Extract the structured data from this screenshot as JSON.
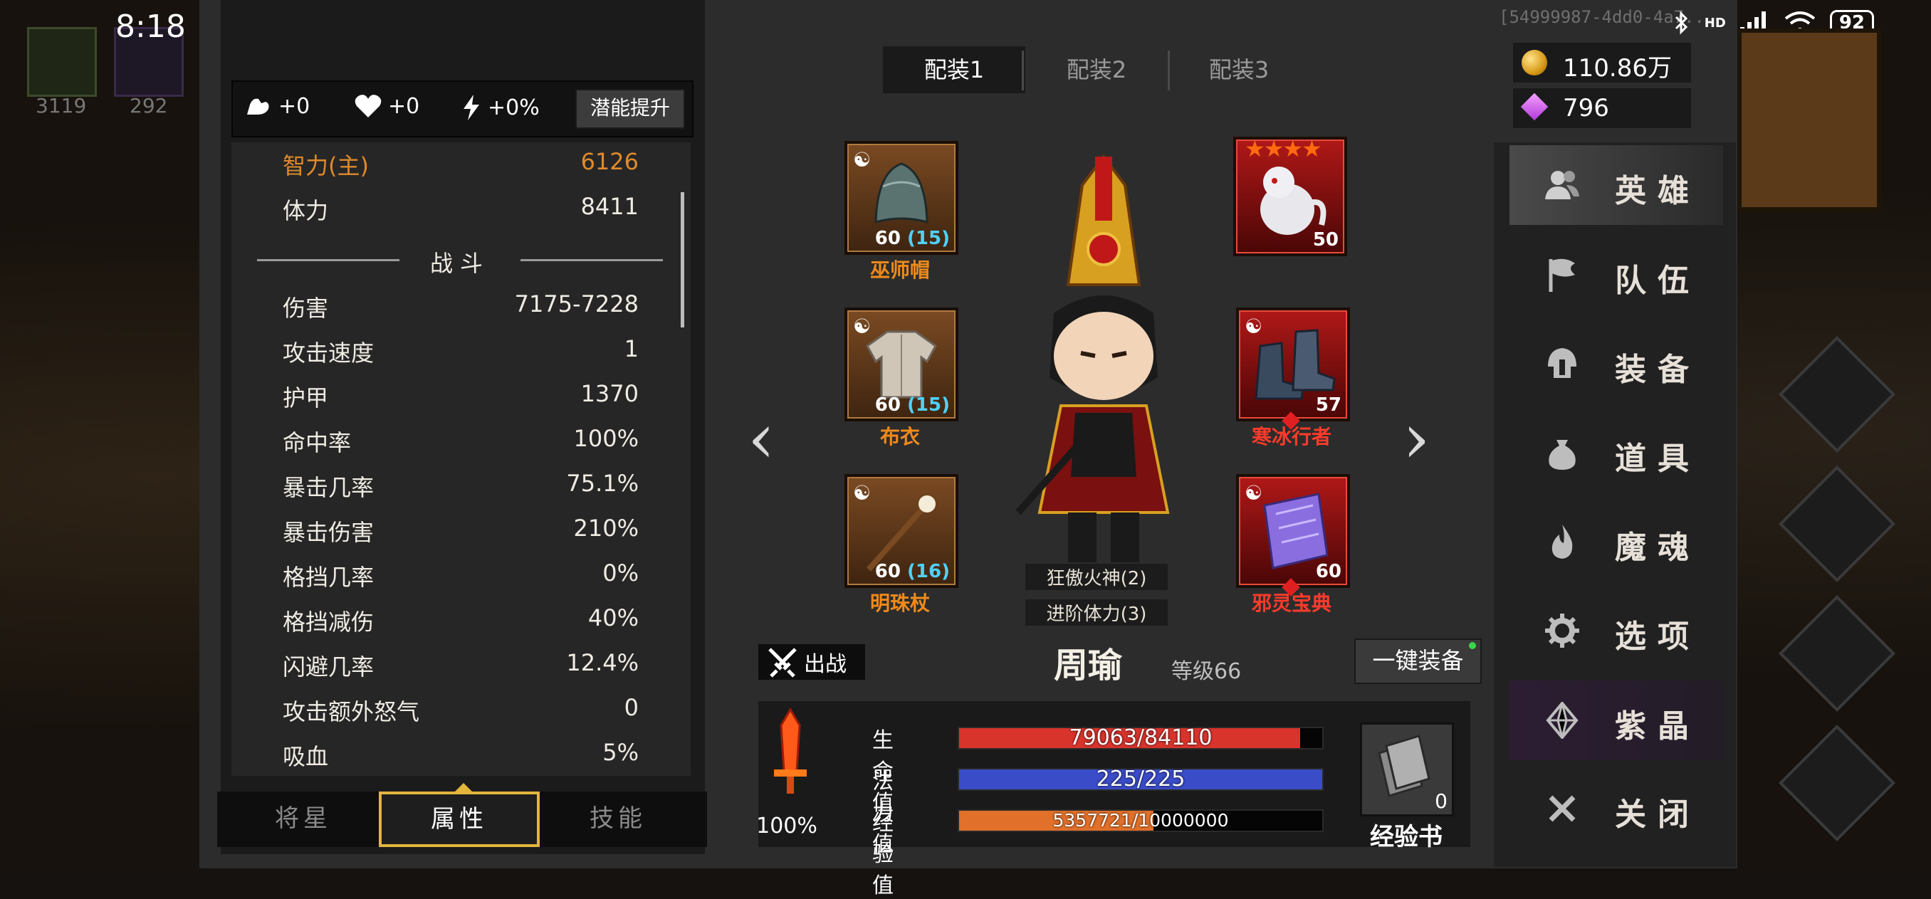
{
  "status_bar": {
    "time": "8:18",
    "debug_id": "[54999987-4dd0-4a7...",
    "network": "HD",
    "battery": "92"
  },
  "left_game": {
    "slot_counts": [
      "3119",
      "292"
    ]
  },
  "potential": {
    "items": [
      {
        "icon": "strength-arm-icon",
        "value": "+0"
      },
      {
        "icon": "heart-icon",
        "value": "+0"
      },
      {
        "icon": "lightning-icon",
        "value": "+0%"
      }
    ],
    "button": "潜能提升"
  },
  "stats": {
    "primary": [
      {
        "label": "智力(主)",
        "value": "6126"
      },
      {
        "label": "体力",
        "value": "8411"
      }
    ],
    "section": "战斗",
    "combat": [
      {
        "label": "伤害",
        "value": "7175-7228"
      },
      {
        "label": "攻击速度",
        "value": "1"
      },
      {
        "label": "护甲",
        "value": "1370"
      },
      {
        "label": "命中率",
        "value": "100%"
      },
      {
        "label": "暴击几率",
        "value": "75.1%"
      },
      {
        "label": "暴击伤害",
        "value": "210%"
      },
      {
        "label": "格挡几率",
        "value": "0%"
      },
      {
        "label": "格挡减伤",
        "value": "40%"
      },
      {
        "label": "闪避几率",
        "value": "12.4%"
      },
      {
        "label": "攻击额外怒气",
        "value": "0"
      },
      {
        "label": "吸血",
        "value": "5%"
      }
    ]
  },
  "bottom_tabs": [
    "将星",
    "属性",
    "技能"
  ],
  "loadout_tabs": [
    "配装1",
    "配装2",
    "配装3"
  ],
  "equipment": {
    "slot1": {
      "name": "巫师帽",
      "level": "60",
      "bonus": "(15)"
    },
    "slot2": {
      "name": "布衣",
      "level": "60",
      "bonus": "(15)"
    },
    "slot3": {
      "name": "明珠杖",
      "level": "60",
      "bonus": "(16)"
    },
    "slot4": {
      "level": "50",
      "stars": "★★★★"
    },
    "slot5": {
      "name": "寒冰行者",
      "level": "57"
    },
    "slot6": {
      "name": "邪灵宝典",
      "level": "60"
    }
  },
  "effects": [
    "狂傲火神(2)",
    "进阶体力(3)"
  ],
  "hero": {
    "sortie": "出战",
    "name": "周瑜",
    "level": "等级66",
    "equip_all": "一键装备"
  },
  "bars": {
    "hp": {
      "label": "生命值",
      "text": "79063/84110",
      "fraction": 0.94
    },
    "mp": {
      "label": "法力值",
      "text": "225/225",
      "fraction": 1.0
    },
    "exp": {
      "label": "经验值",
      "text": "5357721/10000000",
      "fraction": 0.5358
    }
  },
  "rage": "100%",
  "exp_book": {
    "label": "经验书",
    "count": "0"
  },
  "currency": {
    "gold": "110.86万",
    "gems": "796"
  },
  "nav": [
    "英雄",
    "队伍",
    "装备",
    "道具",
    "魔魂",
    "选项",
    "紫晶",
    "关闭"
  ],
  "colors": {
    "accent_gold": "#e3b53c",
    "primary_stat": "#e08a2a",
    "hp": "#d8342c",
    "mp": "#3a4cc8",
    "exp": "#e0702a",
    "bonus": "#4fd1ff"
  }
}
